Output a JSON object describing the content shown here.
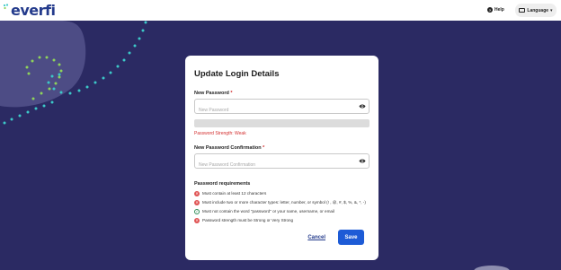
{
  "brand": {
    "name": "everfi"
  },
  "header": {
    "help_label": "Help",
    "language_label": "Language"
  },
  "modal": {
    "title": "Update Login Details",
    "new_password": {
      "label": "New Password",
      "required_mark": "*",
      "placeholder": "New Password",
      "value": ""
    },
    "strength": {
      "text": "Password Strength: Weak",
      "level_fraction": 0
    },
    "confirm_password": {
      "label": "New Password Confirmation",
      "required_mark": "*",
      "placeholder": "New Password Confirmation",
      "value": ""
    },
    "requirements": {
      "title": "Password requirements",
      "items": [
        {
          "text": "Must contain at least 12 characters",
          "status": "fail"
        },
        {
          "text": "Must include two or more character types: letter, number, or symbol (! , @, #, $, %, &, *, -)",
          "status": "fail"
        },
        {
          "text": "Must not contain the word \"password\" or your name, username, or email",
          "status": "pass"
        },
        {
          "text": "Password strength must be Strong or Very Strong",
          "status": "fail"
        }
      ]
    },
    "cancel_label": "Cancel",
    "save_label": "Save"
  },
  "colors": {
    "background": "#2b2a63",
    "accent": "#1d5bd6",
    "error": "#d32f2f",
    "success": "#2e8b57",
    "dots": "#3cc8c8",
    "dots_green": "#8fd45a"
  }
}
